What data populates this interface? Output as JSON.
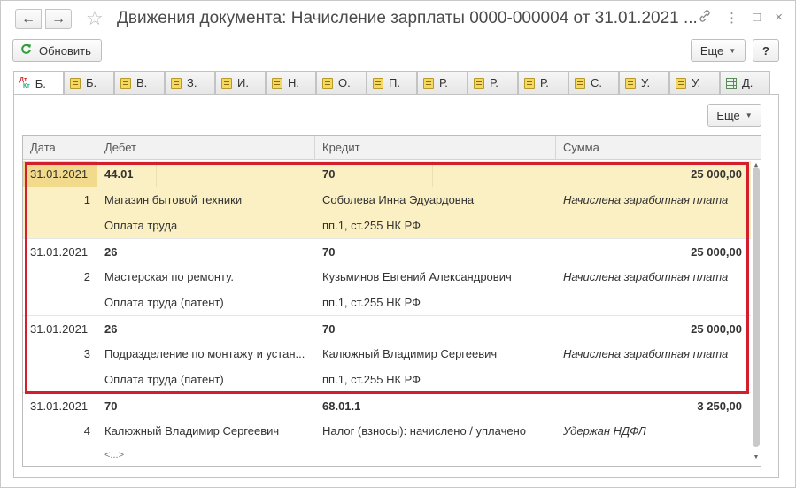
{
  "window": {
    "title": "Движения документа: Начисление зарплаты 0000-000004 от 31.01.2021 ...",
    "nav_back_glyph": "←",
    "nav_fwd_glyph": "→",
    "star_glyph": "☆",
    "link_glyph": "🔗",
    "menu_glyph": "⋮",
    "restore_glyph": "□",
    "close_glyph": "×"
  },
  "toolbar": {
    "refresh_label": "Обновить",
    "more_label": "Еще",
    "help_label": "?"
  },
  "tabs": [
    {
      "label": "Б.",
      "icon": "dt-kt-icon",
      "active": true
    },
    {
      "label": "Б.",
      "icon": "register-icon"
    },
    {
      "label": "В.",
      "icon": "register-icon"
    },
    {
      "label": "З.",
      "icon": "register-icon"
    },
    {
      "label": "И.",
      "icon": "register-icon"
    },
    {
      "label": "Н.",
      "icon": "register-icon"
    },
    {
      "label": "О.",
      "icon": "register-icon"
    },
    {
      "label": "П.",
      "icon": "register-icon"
    },
    {
      "label": "Р.",
      "icon": "register-icon"
    },
    {
      "label": "Р.",
      "icon": "register-icon"
    },
    {
      "label": "Р.",
      "icon": "register-icon"
    },
    {
      "label": "С.",
      "icon": "register-icon"
    },
    {
      "label": "У.",
      "icon": "register-icon"
    },
    {
      "label": "У.",
      "icon": "register-icon"
    },
    {
      "label": "Д.",
      "icon": "table-icon"
    }
  ],
  "panel": {
    "more_label": "Еще"
  },
  "table": {
    "headers": {
      "date": "Дата",
      "debit": "Дебет",
      "credit": "Кредит",
      "sum": "Сумма"
    },
    "groups": [
      {
        "date": "31.01.2021",
        "debit_account": "44.01",
        "credit_account": "70",
        "sum": "25 000,00",
        "num": "1",
        "debit_sub1": "Магазин бытовой техники",
        "credit_sub1": "Соболева Инна Эдуардовна",
        "note": "Начислена заработная плата",
        "debit_sub2": "Оплата труда",
        "credit_sub2": "пп.1, ст.255 НК РФ"
      },
      {
        "date": "31.01.2021",
        "debit_account": "26",
        "credit_account": "70",
        "sum": "25 000,00",
        "num": "2",
        "debit_sub1": "Мастерская по ремонту.",
        "credit_sub1": "Кузьминов Евгений Александрович",
        "note": "Начислена заработная плата",
        "debit_sub2": "Оплата труда (патент)",
        "credit_sub2": "пп.1, ст.255 НК РФ"
      },
      {
        "date": "31.01.2021",
        "debit_account": "26",
        "credit_account": "70",
        "sum": "25 000,00",
        "num": "3",
        "debit_sub1": "Подразделение по монтажу и устан...",
        "credit_sub1": "Калюжный Владимир Сергеевич",
        "note": "Начислена заработная плата",
        "debit_sub2": "Оплата труда (патент)",
        "credit_sub2": "пп.1, ст.255 НК РФ"
      },
      {
        "date": "31.01.2021",
        "debit_account": "70",
        "credit_account": "68.01.1",
        "sum": "3 250,00",
        "num": "4",
        "debit_sub1": "Калюжный Владимир Сергеевич",
        "credit_sub1": "Налог (взносы): начислено / уплачено",
        "note": "Удержан НДФЛ",
        "debit_sub2": "<...>",
        "credit_sub2": ""
      }
    ]
  },
  "colors": {
    "selection_frame": "#d21f2b",
    "current_row": "#fbf0c4",
    "current_cell": "#f2da8c",
    "refresh_icon": "#2e9e3a"
  }
}
